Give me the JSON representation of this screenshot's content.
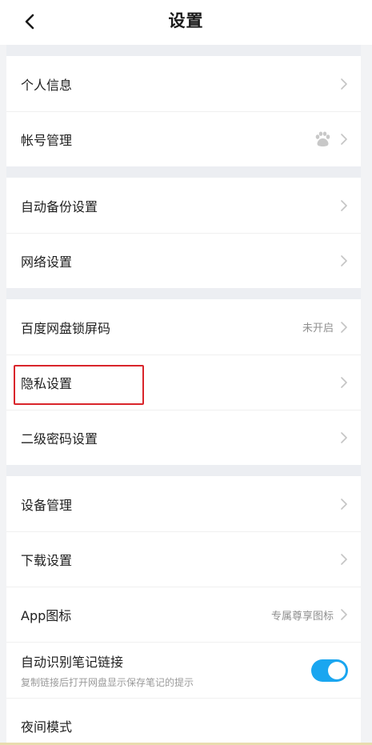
{
  "header": {
    "title": "设置"
  },
  "groups": [
    {
      "items": [
        {
          "label": "个人信息"
        },
        {
          "label": "帐号管理"
        }
      ]
    },
    {
      "items": [
        {
          "label": "自动备份设置"
        },
        {
          "label": "网络设置"
        }
      ]
    },
    {
      "items": [
        {
          "label": "百度网盘锁屏码",
          "value": "未开启"
        },
        {
          "label": "隐私设置"
        },
        {
          "label": "二级密码设置"
        }
      ]
    },
    {
      "items": [
        {
          "label": "设备管理"
        },
        {
          "label": "下载设置"
        },
        {
          "label": "App图标",
          "value": "专属尊享图标"
        },
        {
          "label": "自动识别笔记链接",
          "subtitle": "复制链接后打开网盘显示保存笔记的提示",
          "toggle": true
        },
        {
          "label": "夜间模式"
        }
      ]
    }
  ],
  "icons": {
    "back": "chevron-left-icon",
    "chevron": "chevron-right-icon",
    "account": "baidu-paw-icon"
  },
  "colors": {
    "accent": "#1aa6f0",
    "highlight": "#d9252b"
  }
}
